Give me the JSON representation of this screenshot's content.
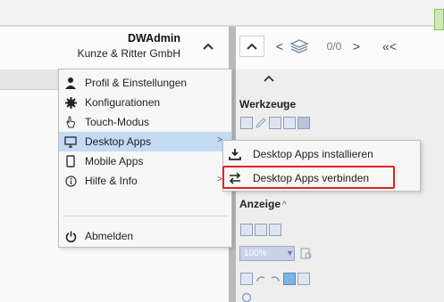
{
  "user": {
    "name": "DWAdmin",
    "company": "Kunze & Ritter GmbH"
  },
  "toolbar": {
    "prev_glyph": "<",
    "page_counter": "0/0",
    "next_glyph": ">",
    "first_glyph": "«<"
  },
  "menu": {
    "items": [
      {
        "label": "Profil & Einstellungen",
        "icon": "user-icon"
      },
      {
        "label": "Konfigurationen",
        "icon": "gear-icon"
      },
      {
        "label": "Touch-Modus",
        "icon": "touch-hand-icon"
      },
      {
        "label": "Desktop Apps",
        "icon": "monitor-icon",
        "has_submenu": true,
        "selected": true
      },
      {
        "label": "Mobile Apps",
        "icon": "mobile-icon"
      },
      {
        "label": "Hilfe & Info",
        "icon": "info-icon",
        "has_submenu": true
      },
      {
        "label": "Abmelden",
        "icon": "power-icon"
      }
    ],
    "submenu_arrow": ">"
  },
  "submenu": {
    "items": [
      {
        "label": "Desktop Apps installieren",
        "icon": "download-icon"
      },
      {
        "label": "Desktop Apps verbinden",
        "icon": "swap-arrows-icon",
        "highlighted": true
      }
    ]
  },
  "side_panel": {
    "werkzeuge_label": "Werkzeuge",
    "anzeige_label": "Anzeige",
    "zoom_value": "100%"
  },
  "colors": {
    "selection": "#c3dbf3",
    "highlight_border": "#e02020",
    "divider": "#b9b9b9"
  }
}
